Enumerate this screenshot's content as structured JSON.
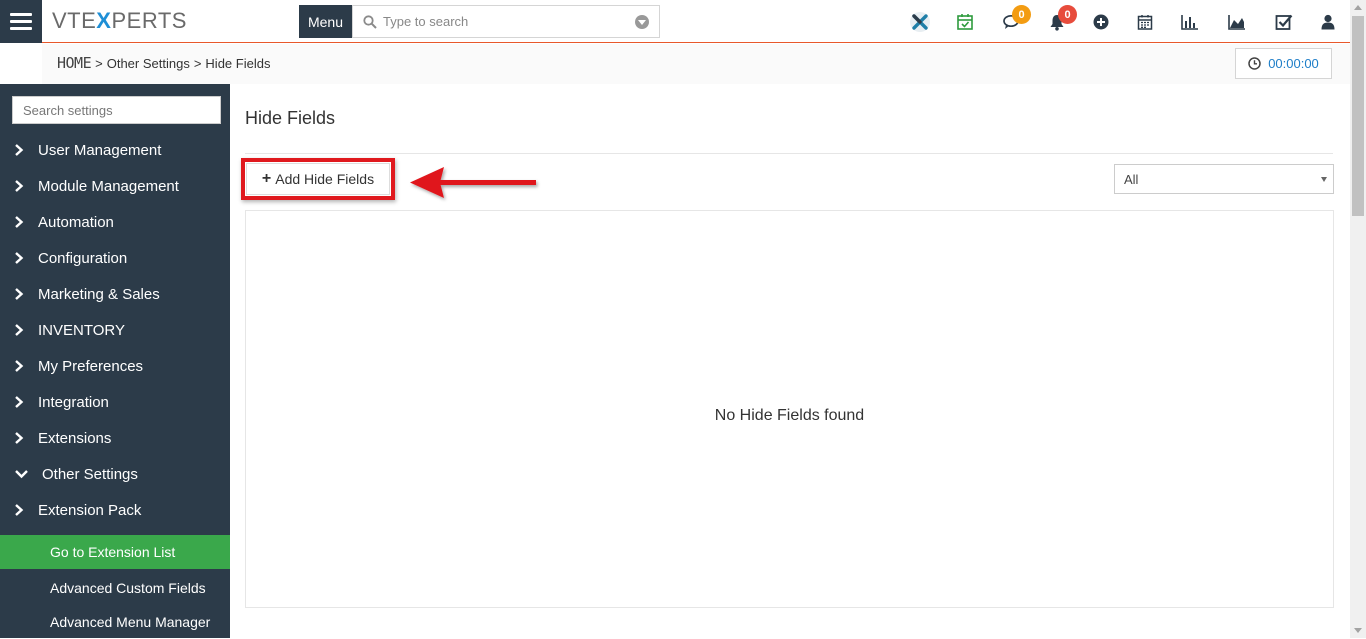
{
  "header": {
    "logo_prefix": "VTE",
    "logo_x": "X",
    "logo_suffix": "PERTS",
    "menu_label": "Menu",
    "search_placeholder": "Type to search",
    "chat_badge": "0",
    "notification_badge": "0"
  },
  "breadcrumb": {
    "home": "HOME",
    "sep1": ">",
    "parent": "Other Settings",
    "sep2": ">",
    "current": "Hide Fields"
  },
  "timer": {
    "value": "00:00:00"
  },
  "sidebar": {
    "search_placeholder": "Search settings",
    "items": [
      {
        "label": "User Management"
      },
      {
        "label": "Module Management"
      },
      {
        "label": "Automation"
      },
      {
        "label": "Configuration"
      },
      {
        "label": "Marketing & Sales"
      },
      {
        "label": "INVENTORY"
      },
      {
        "label": "My Preferences"
      },
      {
        "label": "Integration"
      },
      {
        "label": "Extensions"
      },
      {
        "label": "Other Settings"
      },
      {
        "label": "Extension Pack"
      }
    ],
    "subitems": [
      {
        "label": "Go to Extension List"
      },
      {
        "label": "Advanced Custom Fields"
      },
      {
        "label": "Advanced Menu Manager"
      }
    ]
  },
  "main": {
    "title": "Hide Fields",
    "add_button_label": "Add Hide Fields",
    "add_button_plus": "+",
    "filter_value": "All",
    "empty_message": "No Hide Fields found"
  },
  "colors": {
    "sidebar_bg": "#2c3b49",
    "active_item": "#3aa84b",
    "accent_line": "#e8582b",
    "highlight_red": "#e0191e",
    "badge_orange": "#f39c12",
    "badge_red": "#e74c3c",
    "link_blue": "#1e7ec8"
  }
}
